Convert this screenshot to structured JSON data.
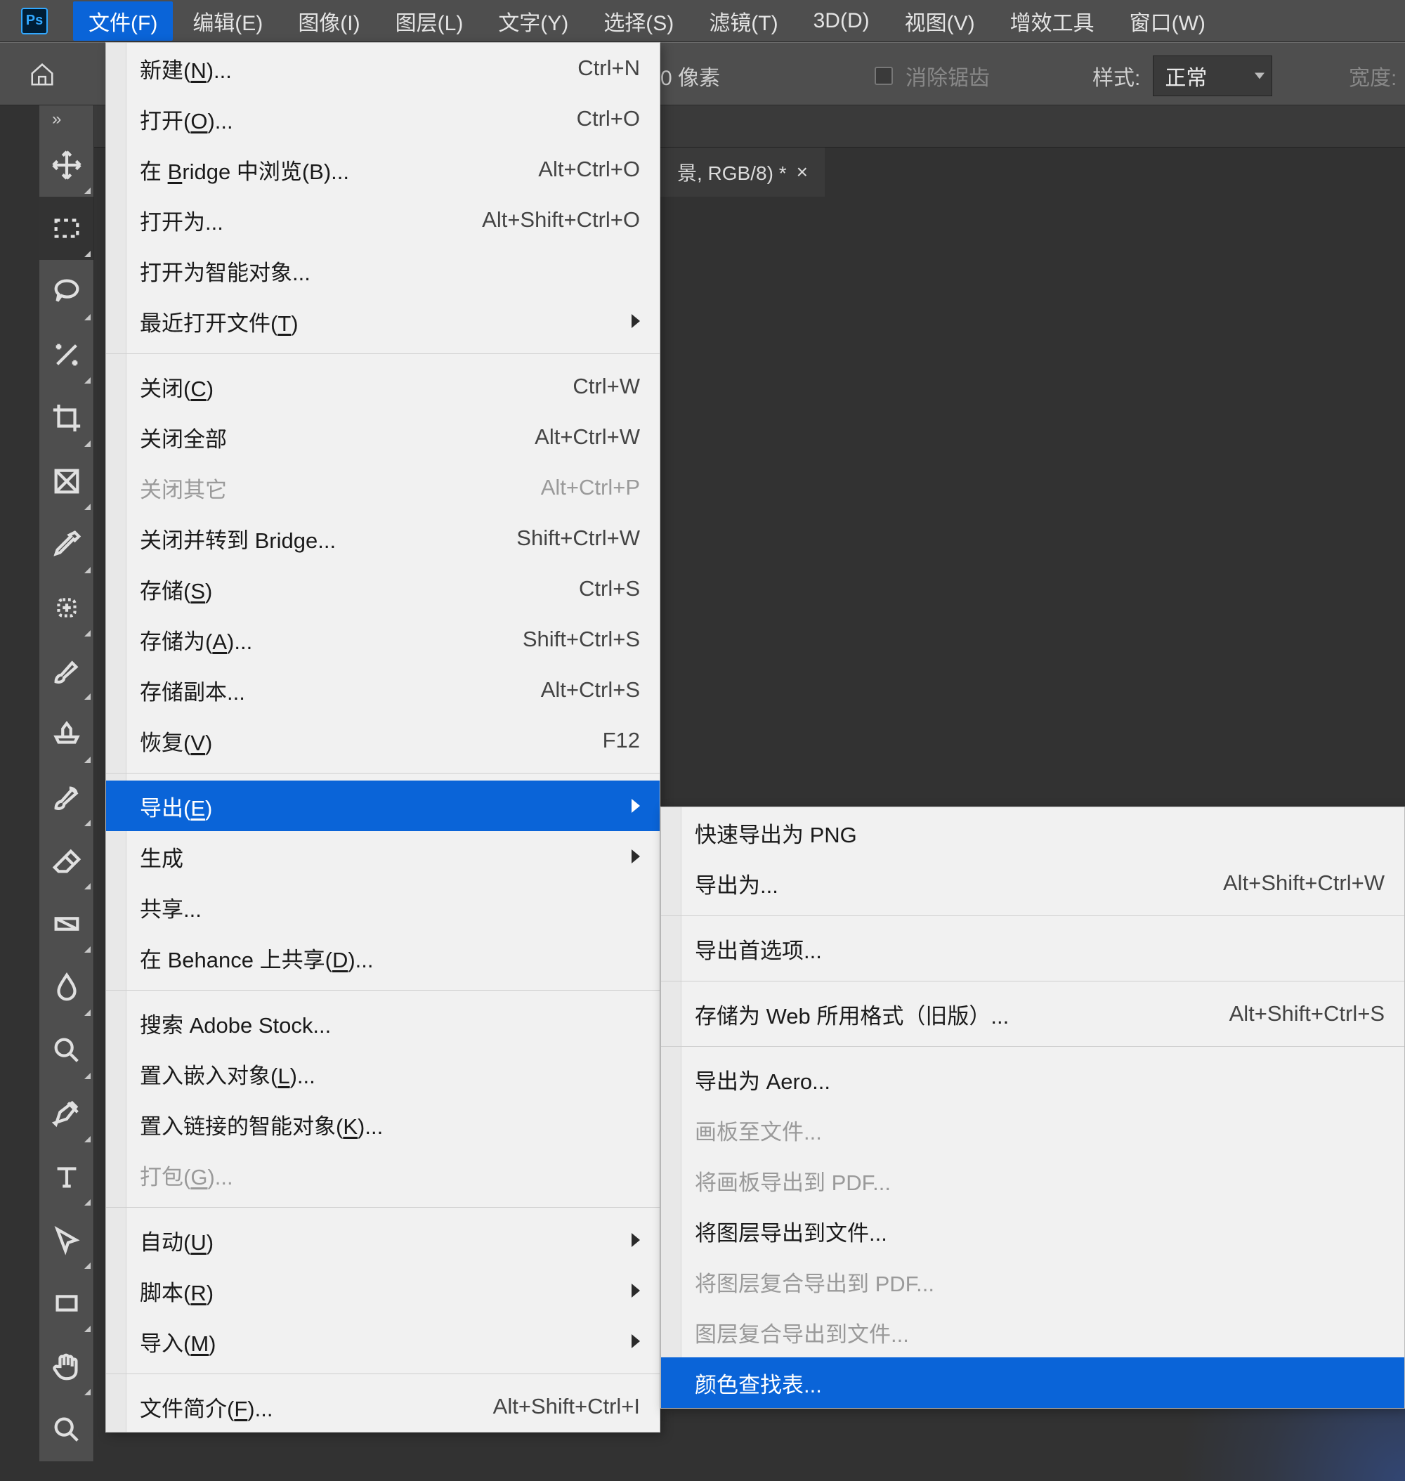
{
  "app": {
    "name": "Ps"
  },
  "menubar": {
    "items": [
      {
        "label": "文件(F)",
        "active": true
      },
      {
        "label": "编辑(E)"
      },
      {
        "label": "图像(I)"
      },
      {
        "label": "图层(L)"
      },
      {
        "label": "文字(Y)"
      },
      {
        "label": "选择(S)"
      },
      {
        "label": "滤镜(T)"
      },
      {
        "label": "3D(D)"
      },
      {
        "label": "视图(V)"
      },
      {
        "label": "增效工具"
      },
      {
        "label": "窗口(W)"
      }
    ]
  },
  "optionsbar": {
    "pixels_suffix": "0 像素",
    "antialias_label": "消除锯齿",
    "style_label": "样式:",
    "style_value": "正常",
    "width_label": "宽度:"
  },
  "document_tab": {
    "title_visible_fragment": "景, RGB/8) *",
    "close": "×"
  },
  "file_menu": {
    "items": [
      {
        "label": "新建(N)...",
        "hotkey": "N",
        "accel": "Ctrl+N"
      },
      {
        "label": "打开(O)...",
        "hotkey": "O",
        "accel": "Ctrl+O"
      },
      {
        "label": "在 Bridge 中浏览(B)...",
        "hotkey": "B",
        "accel": "Alt+Ctrl+O"
      },
      {
        "label": "打开为...",
        "accel": "Alt+Shift+Ctrl+O"
      },
      {
        "label": "打开为智能对象..."
      },
      {
        "label": "最近打开文件(T)",
        "hotkey": "T",
        "submenu": true
      },
      {
        "sep": true
      },
      {
        "label": "关闭(C)",
        "hotkey": "C",
        "accel": "Ctrl+W"
      },
      {
        "label": "关闭全部",
        "accel": "Alt+Ctrl+W"
      },
      {
        "label": "关闭其它",
        "accel": "Alt+Ctrl+P",
        "disabled": true
      },
      {
        "label": "关闭并转到 Bridge...",
        "accel": "Shift+Ctrl+W"
      },
      {
        "label": "存储(S)",
        "hotkey": "S",
        "accel": "Ctrl+S"
      },
      {
        "label": "存储为(A)...",
        "hotkey": "A",
        "accel": "Shift+Ctrl+S"
      },
      {
        "label": "存储副本...",
        "accel": "Alt+Ctrl+S"
      },
      {
        "label": "恢复(V)",
        "hotkey": "V",
        "accel": "F12"
      },
      {
        "sep": true
      },
      {
        "label": "导出(E)",
        "hotkey": "E",
        "submenu": true,
        "highlight": true
      },
      {
        "label": "生成",
        "submenu": true
      },
      {
        "label": "共享..."
      },
      {
        "label": "在 Behance 上共享(D)...",
        "hotkey": "D"
      },
      {
        "sep": true
      },
      {
        "label": "搜索 Adobe Stock..."
      },
      {
        "label": "置入嵌入对象(L)...",
        "hotkey": "L"
      },
      {
        "label": "置入链接的智能对象(K)...",
        "hotkey": "K"
      },
      {
        "label": "打包(G)...",
        "hotkey": "G",
        "disabled": true
      },
      {
        "sep": true
      },
      {
        "label": "自动(U)",
        "hotkey": "U",
        "submenu": true
      },
      {
        "label": "脚本(R)",
        "hotkey": "R",
        "submenu": true
      },
      {
        "label": "导入(M)",
        "hotkey": "M",
        "submenu": true
      },
      {
        "sep": true
      },
      {
        "label": "文件简介(F)...",
        "hotkey": "F",
        "accel": "Alt+Shift+Ctrl+I"
      }
    ]
  },
  "export_submenu": {
    "items": [
      {
        "label": "快速导出为 PNG"
      },
      {
        "label": "导出为...",
        "accel": "Alt+Shift+Ctrl+W"
      },
      {
        "sep": true
      },
      {
        "label": "导出首选项..."
      },
      {
        "sep": true
      },
      {
        "label": "存储为 Web 所用格式（旧版）...",
        "accel": "Alt+Shift+Ctrl+S"
      },
      {
        "sep": true
      },
      {
        "label": "导出为 Aero..."
      },
      {
        "label": "画板至文件...",
        "disabled": true
      },
      {
        "label": "将画板导出到 PDF...",
        "disabled": true
      },
      {
        "label": "将图层导出到文件..."
      },
      {
        "label": "将图层复合导出到 PDF...",
        "disabled": true
      },
      {
        "label": "图层复合导出到文件...",
        "disabled": true
      },
      {
        "label": "颜色查找表...",
        "highlight": true
      }
    ]
  },
  "toolbar_expand": "»",
  "tool_names": [
    "move-tool",
    "rectangular-marquee-tool",
    "lasso-tool",
    "magic-wand-tool",
    "crop-tool",
    "frame-tool",
    "eyedropper-tool",
    "spot-healing-brush-tool",
    "brush-tool",
    "clone-stamp-tool",
    "history-brush-tool",
    "eraser-tool",
    "gradient-tool",
    "blur-tool",
    "dodge-tool",
    "pen-tool",
    "type-tool",
    "path-selection-tool",
    "rectangle-tool",
    "hand-tool",
    "zoom-tool"
  ]
}
